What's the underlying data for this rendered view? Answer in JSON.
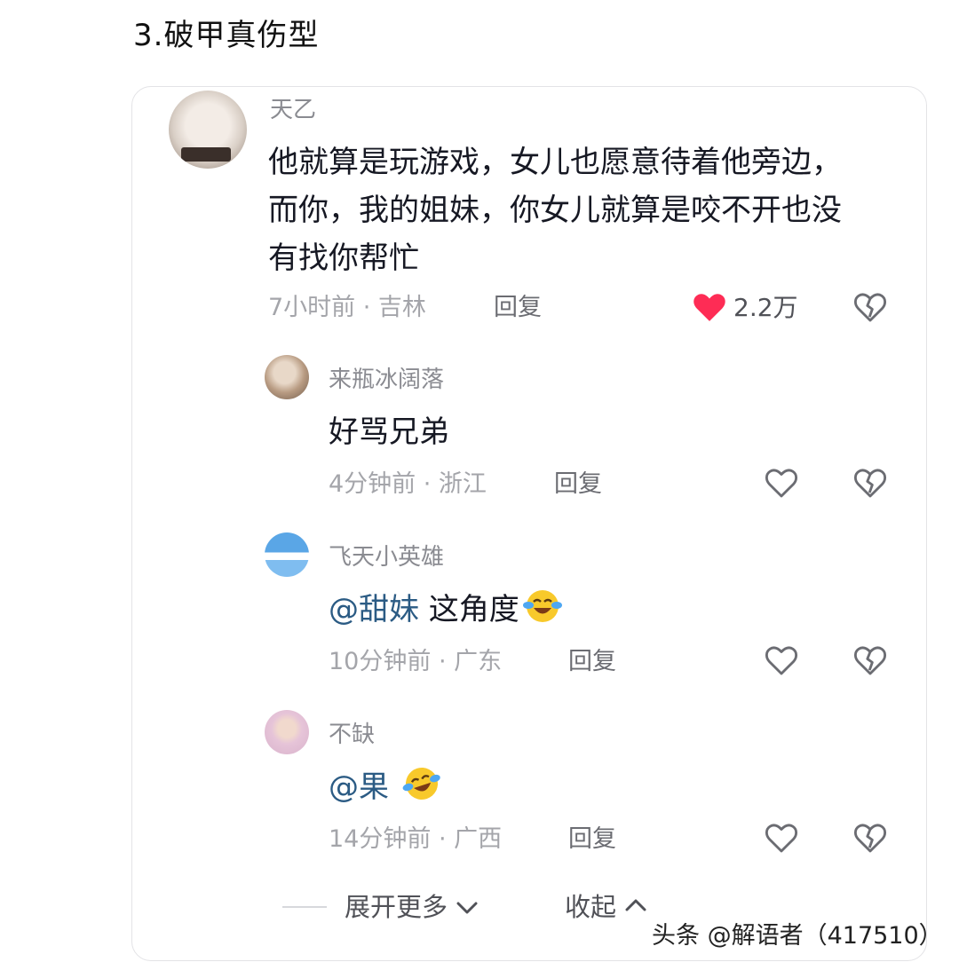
{
  "heading": "3.破甲真伤型",
  "colors": {
    "like_active": "#fe2c55",
    "mention": "#2b5b84",
    "meta": "#a4a5aa"
  },
  "icons": {
    "like_filled": "heart-filled-icon",
    "like_outline": "heart-outline-icon",
    "dislike": "broken-heart-icon",
    "chevron_down": "chevron-down-icon",
    "chevron_up": "chevron-up-icon",
    "emoji": "crying-laughing-emoji"
  },
  "main_comment": {
    "username": "天乙",
    "lines": [
      "他就算是玩游戏，女儿也愿意待着他旁边，",
      "而你，我的姐妹，你女儿就算是咬不开也没",
      "有找你帮忙"
    ],
    "time_location": "7小时前 · 吉林",
    "reply_label": "回复",
    "like_count": "2.2万",
    "liked": true
  },
  "replies": [
    {
      "username": "来瓶冰阔落",
      "mention": "",
      "text": "好骂兄弟",
      "emoji": false,
      "time_location": "4分钟前 · 浙江",
      "reply_label": "回复"
    },
    {
      "username": "飞天小英雄",
      "mention": "@甜妹",
      "text": " 这角度",
      "emoji": true,
      "time_location": "10分钟前 · 广东",
      "reply_label": "回复"
    },
    {
      "username": "不缺",
      "mention": "@果",
      "text": " ",
      "emoji": true,
      "time_location": "14分钟前 · 广西",
      "reply_label": "回复"
    }
  ],
  "footer": {
    "expand_label": "展开更多",
    "collapse_label": "收起"
  },
  "watermark": "头条 @解语者（417510）"
}
